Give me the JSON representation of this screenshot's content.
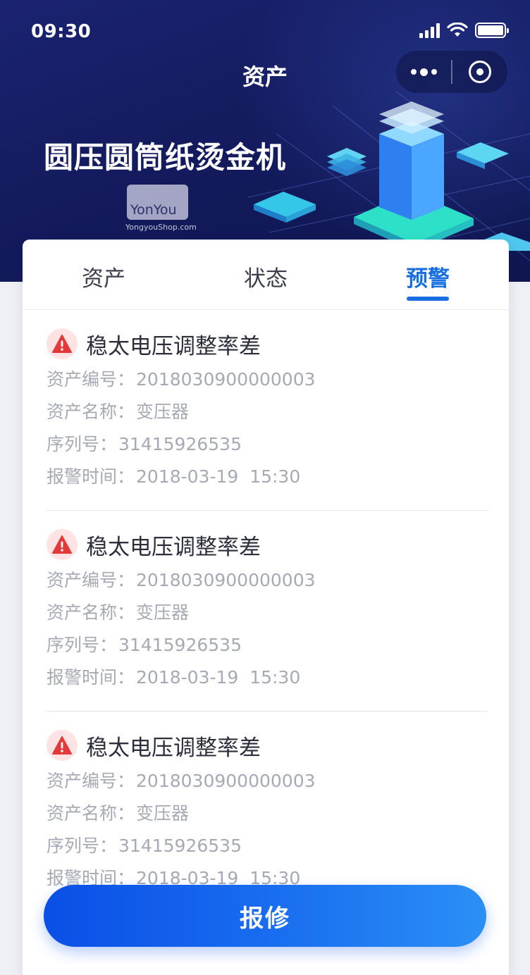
{
  "status_bar": {
    "time": "09:30"
  },
  "nav": {
    "title": "资产"
  },
  "hero": {
    "asset_name": "圆压圆筒纸烫金机",
    "logo_text": "YonYou",
    "logo_caption": "YongyouShop.com"
  },
  "tabs": [
    {
      "label": "资产",
      "active": false
    },
    {
      "label": "状态",
      "active": false
    },
    {
      "label": "预警",
      "active": true
    }
  ],
  "alerts": [
    {
      "title": "稳太电压调整率差",
      "asset_no_label": "资产编号：",
      "asset_no": "2018030900000003",
      "asset_name_label": "资产名称：",
      "asset_name": "变压器",
      "serial_label": "序列号：",
      "serial": "31415926535",
      "time_label": "报警时间：",
      "time": "2018-03-19  15:30"
    },
    {
      "title": "稳太电压调整率差",
      "asset_no_label": "资产编号：",
      "asset_no": "2018030900000003",
      "asset_name_label": "资产名称：",
      "asset_name": "变压器",
      "serial_label": "序列号：",
      "serial": "31415926535",
      "time_label": "报警时间：",
      "time": "2018-03-19  15:30"
    },
    {
      "title": "稳太电压调整率差",
      "asset_no_label": "资产编号：",
      "asset_no": "2018030900000003",
      "asset_name_label": "资产名称：",
      "asset_name": "变压器",
      "serial_label": "序列号：",
      "serial": "31415926535",
      "time_label": "报警时间：",
      "time": "2018-03-19  15:30"
    }
  ],
  "actions": {
    "repair_label": "报修"
  },
  "colors": {
    "accent": "#1a6fe0",
    "header_bg": "#141b5e",
    "warning": "#e23a3a"
  }
}
